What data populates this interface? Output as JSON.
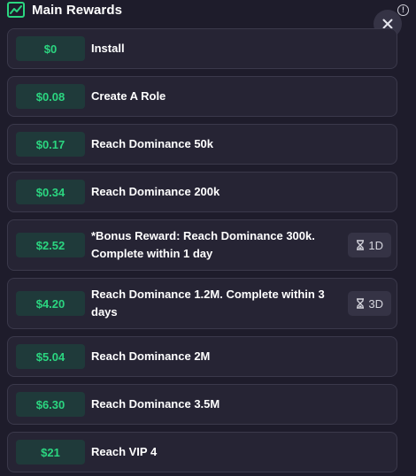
{
  "header": {
    "title": "Main Rewards",
    "icon": "chart-icon"
  },
  "colors": {
    "background": "#1e1c2b",
    "card": "#262434",
    "amount_text": "#2bd680",
    "amount_bg": "#1f3a3a",
    "header_icon": "#2bd680"
  },
  "rewards": [
    {
      "amount": "$0",
      "label": "Install"
    },
    {
      "amount": "$0.08",
      "label": "Create A Role"
    },
    {
      "amount": "$0.17",
      "label": "Reach Dominance 50k"
    },
    {
      "amount": "$0.34",
      "label": "Reach Dominance 200k"
    },
    {
      "amount": "$2.52",
      "label_line1": "*Bonus Reward: Reach Dominance 300k.",
      "label_line2": "Complete within 1 day",
      "timer": "1D",
      "timer_icon": "hourglass-icon"
    },
    {
      "amount": "$4.20",
      "label_line1": "Reach Dominance 1.2M. Complete within 3",
      "label_line2": "days",
      "timer": "3D",
      "timer_icon": "hourglass-icon"
    },
    {
      "amount": "$5.04",
      "label": "Reach Dominance 2M"
    },
    {
      "amount": "$6.30",
      "label": "Reach Dominance 3.5M"
    },
    {
      "amount": "$21",
      "label": "Reach VIP 4"
    }
  ]
}
